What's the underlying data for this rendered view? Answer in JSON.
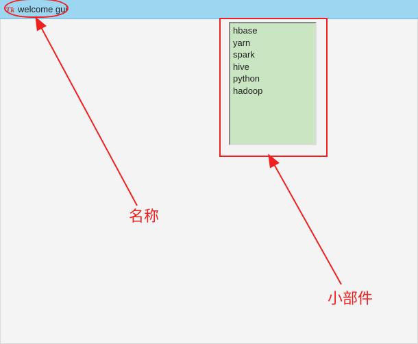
{
  "window": {
    "title": "welcome gui",
    "icon_name": "tk-feather-icon"
  },
  "listbox": {
    "items": [
      "hbase",
      "yarn",
      "spark",
      "hive",
      "python",
      "hadoop"
    ]
  },
  "annotations": {
    "name_label": "名称",
    "widget_label": "小部件"
  }
}
